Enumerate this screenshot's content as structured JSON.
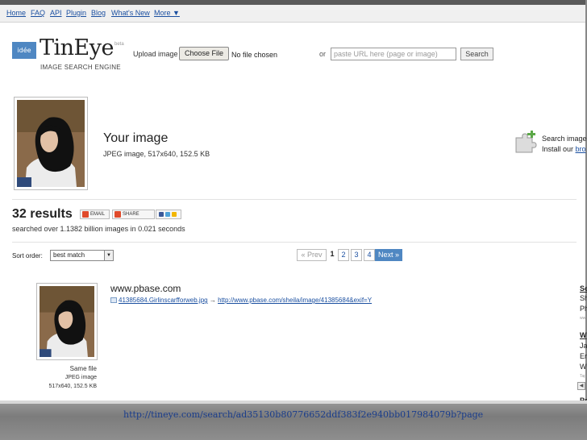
{
  "nav": [
    "Home",
    "FAQ",
    "API",
    "Plugin",
    "Blog",
    "What's New",
    "More ▼"
  ],
  "logo": {
    "box": "idée",
    "name": "TinEye",
    "beta": "beta",
    "subtitle": "IMAGE SEARCH ENGINE"
  },
  "upload": {
    "label": "Upload image",
    "button": "Choose File",
    "no_file": "No file chosen",
    "or": "or",
    "url_placeholder": "paste URL here (page or image)",
    "search_button": "Search"
  },
  "your_image": {
    "title": "Your image",
    "meta": "JPEG image, 517x640, 152.5 KB"
  },
  "promo": {
    "line1": "Search image",
    "line2_prefix": "Install our ",
    "line2_link": "bro"
  },
  "results": {
    "count": "32 results",
    "email": "EMAIL",
    "share": "SHARE",
    "searched": "searched over 1.1382 billion images in 0.021 seconds"
  },
  "sort": {
    "label": "Sort order:",
    "value": "best match"
  },
  "pagination": {
    "prev": "« Prev",
    "pages": [
      "1",
      "2",
      "3",
      "4"
    ],
    "next": "Next »"
  },
  "match": {
    "site": "www.pbase.com",
    "file": "41385684.Girlinscarfforweb.jpg",
    "arrow": "→",
    "url": "http://www.pbase.com/sheila/image/41385684&exif=Y",
    "caption1": "Same file",
    "caption2": "JPEG image",
    "caption3": "517x640, 152.5 KB"
  },
  "right_column": [
    "Se",
    "Sh",
    "Ph",
    "ww",
    "W",
    "Ja",
    "Er",
    "W",
    "Tap",
    "Pr"
  ],
  "footer_url": "http://tineye.com/search/ad35130b80776652ddf383f2e940bb017984079b?page",
  "colors": {
    "accent": "#4f87c2",
    "link": "#1a4fa0"
  }
}
